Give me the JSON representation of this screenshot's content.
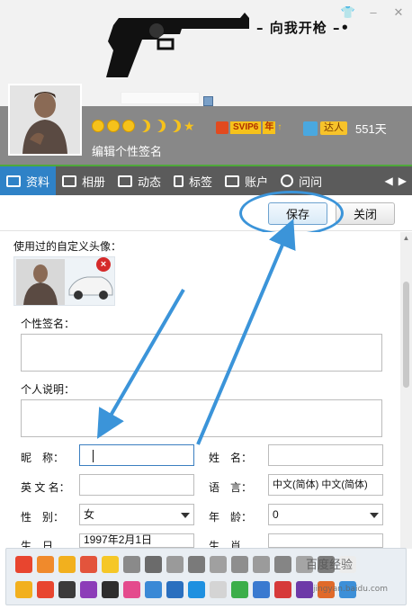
{
  "window": {
    "buttons": {
      "skin": "skin-icon",
      "minimize": "minimize-icon",
      "close": "close-icon"
    }
  },
  "header": {
    "skin_text": "– 向我开枪 –•",
    "level_icons": [
      "sun-icon",
      "sun-icon",
      "sun-icon",
      "moon-icon",
      "moon-icon",
      "moon-icon",
      "star-icon"
    ],
    "vip_label": "SVIP6",
    "vip_year": "年",
    "vip_arrow": "↑",
    "daren_label": "达人",
    "days": "551天",
    "signature_placeholder": "编辑个性签名"
  },
  "tabs": [
    {
      "label": "资料",
      "icon": "profile-card-icon",
      "active": true
    },
    {
      "label": "相册",
      "icon": "album-icon",
      "active": false
    },
    {
      "label": "动态",
      "icon": "feed-icon",
      "active": false
    },
    {
      "label": "标签",
      "icon": "tag-icon",
      "active": false
    },
    {
      "label": "账户",
      "icon": "account-icon",
      "active": false
    },
    {
      "label": "问问",
      "icon": "question-icon",
      "active": false
    }
  ],
  "toolbar": {
    "save_label": "保存",
    "close_label": "关闭"
  },
  "form": {
    "custom_avatar_label": "使用过的自定义头像：",
    "signature_label": "个性签名：",
    "description_label": "个人说明：",
    "nickname_label": "昵　称：",
    "name_label": "姓　名：",
    "english_name_label": "英 文 名：",
    "language_label": "语　言：",
    "language_value": "中文(简体)  中文(简体)",
    "gender_label": "性　别：",
    "gender_value": "女",
    "age_label": "年　龄：",
    "age_value": "0",
    "birthday_label": "生　日",
    "birthday_value": "1997年2月1日",
    "zodiac_label": "生　肖",
    "delete_label": "×"
  },
  "watermark": {
    "text": "百度经验",
    "url": "jingyan.baidu.com"
  },
  "colors": {
    "accent": "#2f82c7",
    "annotation": "#3b94d9",
    "tab_bar": "#5b5b5b",
    "tab_border": "#4fa93a",
    "header_strip": "#888888"
  }
}
